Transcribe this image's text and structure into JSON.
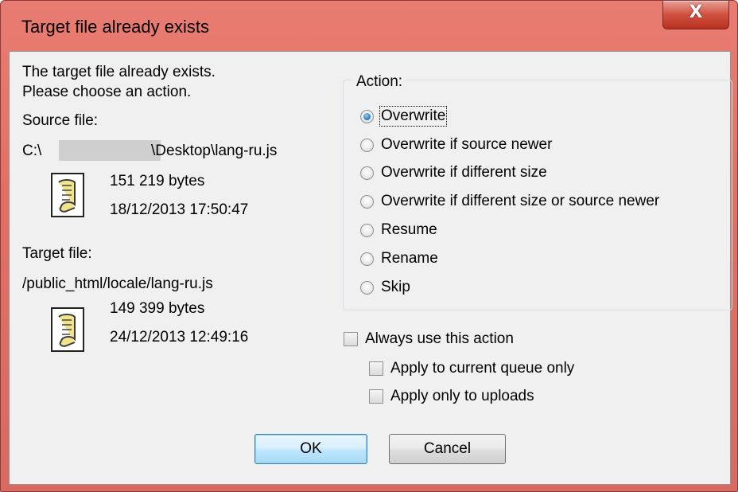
{
  "window": {
    "title": "Target file already exists",
    "close_glyph": "X"
  },
  "message": {
    "line1": "The target file already exists.",
    "line2": "Please choose an action."
  },
  "source": {
    "label": "Source file:",
    "path_prefix": "C:\\",
    "path_suffix": "\\Desktop\\lang-ru.js",
    "size": "151 219 bytes",
    "date": "18/12/2013 17:50:47",
    "icon": "script-file-icon"
  },
  "target": {
    "label": "Target file:",
    "path": "/public_html/locale/lang-ru.js",
    "size": "149 399 bytes",
    "date": "24/12/2013 12:49:16",
    "icon": "script-file-icon"
  },
  "action": {
    "label": "Action:",
    "selected": "Overwrite",
    "options": [
      {
        "label": "Overwrite",
        "checked": true
      },
      {
        "label": "Overwrite if source newer",
        "checked": false
      },
      {
        "label": "Overwrite if different size",
        "checked": false
      },
      {
        "label": "Overwrite if different size or source newer",
        "checked": false
      },
      {
        "label": "Resume",
        "checked": false
      },
      {
        "label": "Rename",
        "checked": false
      },
      {
        "label": "Skip",
        "checked": false
      }
    ]
  },
  "options": {
    "always": {
      "label": "Always use this action",
      "checked": false
    },
    "current_queue": {
      "label": "Apply to current queue only",
      "checked": false
    },
    "uploads_only": {
      "label": "Apply only to uploads",
      "checked": false
    }
  },
  "buttons": {
    "ok": "OK",
    "cancel": "Cancel"
  },
  "colors": {
    "titlebar": "#e07066",
    "client": "#f0f0f0",
    "radio_selected": "#2a7fc8",
    "ok_border": "#3c7fb1"
  }
}
